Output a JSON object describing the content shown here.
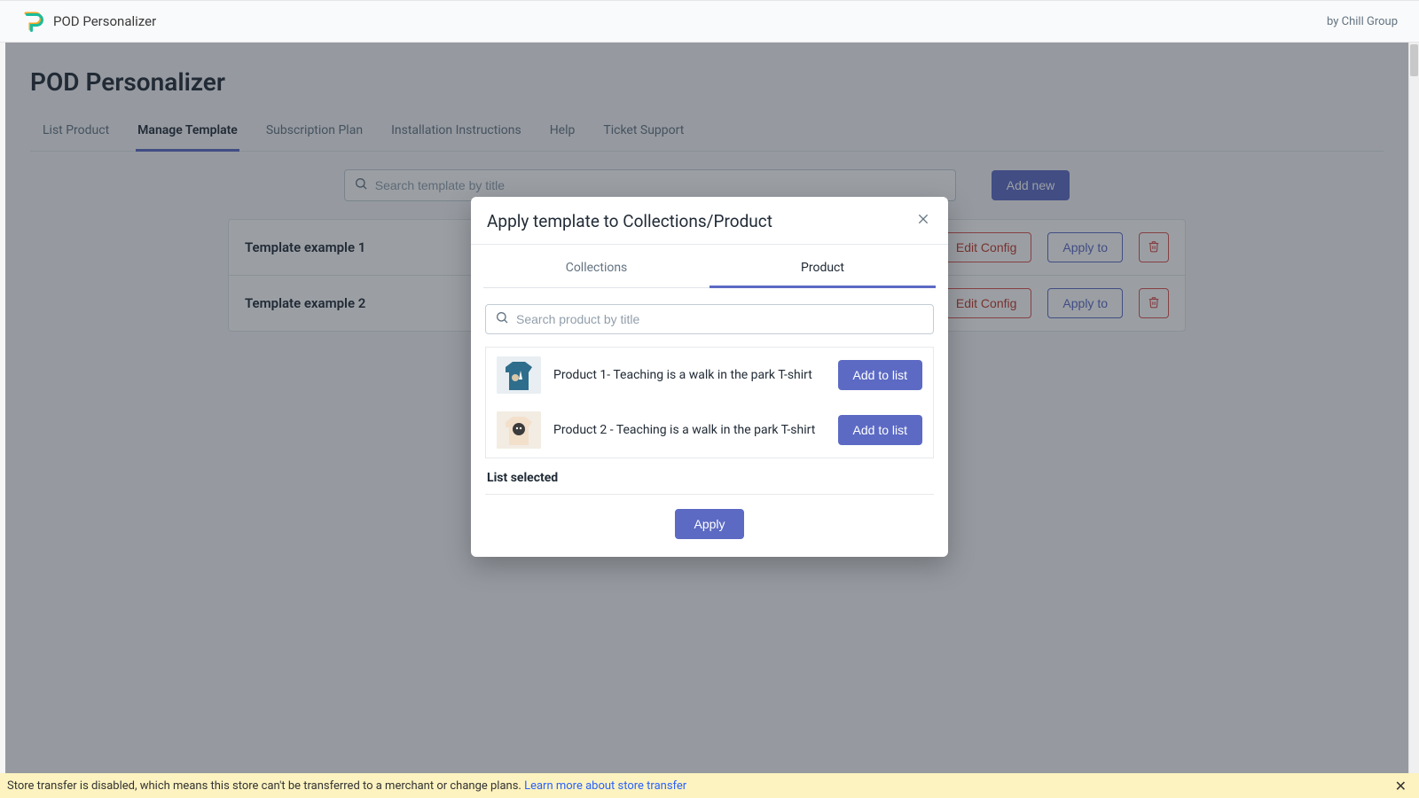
{
  "topbar": {
    "app_name": "POD Personalizer",
    "byline": "by Chill Group"
  },
  "page_title": "POD Personalizer",
  "nav_tabs": [
    {
      "label": "List Product",
      "active": false
    },
    {
      "label": "Manage Template",
      "active": true
    },
    {
      "label": "Subscription Plan",
      "active": false
    },
    {
      "label": "Installation Instructions",
      "active": false
    },
    {
      "label": "Help",
      "active": false
    },
    {
      "label": "Ticket Support",
      "active": false
    }
  ],
  "search_placeholder": "Search template by title",
  "add_new_label": "Add new",
  "templates": [
    {
      "name": "Template example 1",
      "edit_label": "Edit Config",
      "apply_label": "Apply to"
    },
    {
      "name": "Template example 2",
      "edit_label": "Edit Config",
      "apply_label": "Apply to"
    }
  ],
  "modal": {
    "title": "Apply template to Collections/Product",
    "tabs": {
      "collections": "Collections",
      "product": "Product"
    },
    "search_placeholder": "Search product by title",
    "products": [
      {
        "title": "Product 1- Teaching is a walk in the park T-shirt",
        "button": "Add to list"
      },
      {
        "title": "Product 2 - Teaching is a walk in the park T-shirt",
        "button": "Add to list"
      }
    ],
    "list_selected_label": "List selected",
    "apply_label": "Apply"
  },
  "banner": {
    "text": "Store transfer is disabled, which means this store can't be transferred to a merchant or change plans. ",
    "link": "Learn more about store transfer"
  }
}
